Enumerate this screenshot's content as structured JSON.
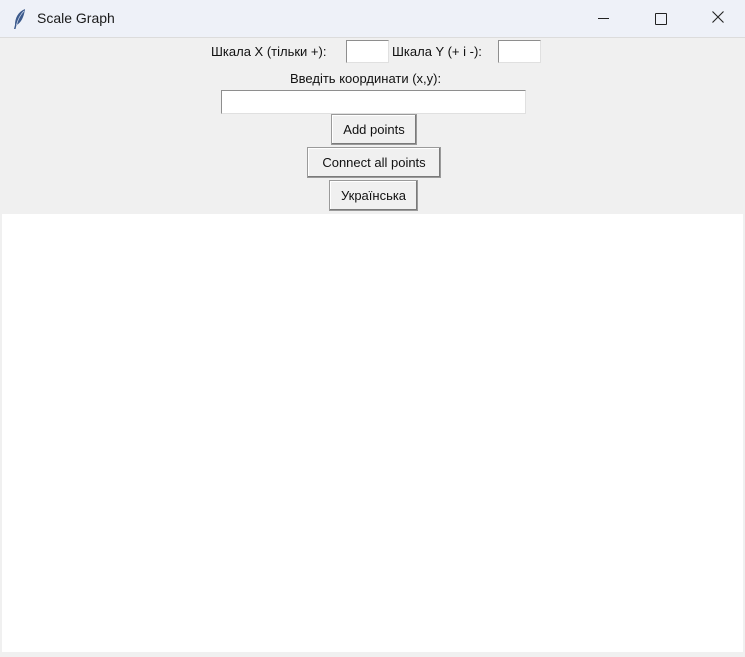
{
  "window": {
    "title": "Scale Graph",
    "icon": "feather-icon"
  },
  "titlebar_buttons": {
    "minimize": "minimize-icon",
    "maximize": "maximize-icon",
    "close": "close-icon"
  },
  "controls": {
    "scale_x_label": "Шкала X (тільки +):",
    "scale_x_value": "",
    "scale_y_label": "Шкала Y (+ і -):",
    "scale_y_value": "",
    "coords_label": "Введіть координати (x,y):",
    "coords_value": "",
    "add_points_label": "Add points",
    "connect_points_label": "Connect all points",
    "language_label": "Українська"
  },
  "colors": {
    "window_bg": "#f0f0f0",
    "titlebar_bg": "#eef1f8",
    "canvas_bg": "#ffffff"
  }
}
